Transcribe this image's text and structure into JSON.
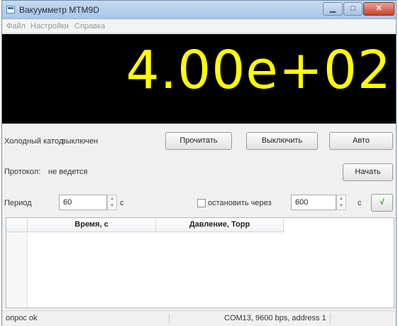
{
  "window": {
    "title": "Вакуумметр МТМ9D",
    "controls": {
      "minimize": "▁",
      "maximize": "□",
      "close": "✕"
    }
  },
  "menu": [
    "Файл",
    "Настройки",
    "Справка"
  ],
  "display": {
    "value": "4.00e+02",
    "color": "#ffff00",
    "background": "#000000"
  },
  "cathode": {
    "label": "Холодный катод:",
    "state": "выключен",
    "read_button": "Прочитать",
    "off_button": "Выключить",
    "auto_button": "Авто"
  },
  "protocol": {
    "label": "Протокол:",
    "state": "не ведется",
    "start_button": "Начать"
  },
  "period": {
    "label": "Период",
    "value": "60",
    "unit": "с",
    "stop_checkbox_label": "остановить через",
    "stop_checked": false,
    "stop_value": "600",
    "stop_unit": "с",
    "apply_button": "√"
  },
  "table": {
    "columns": [
      "Время, с",
      "Давление, Торр"
    ],
    "rows": []
  },
  "status": {
    "left": "опрос ok",
    "right": "COM13, 9600 bps, address 1"
  }
}
